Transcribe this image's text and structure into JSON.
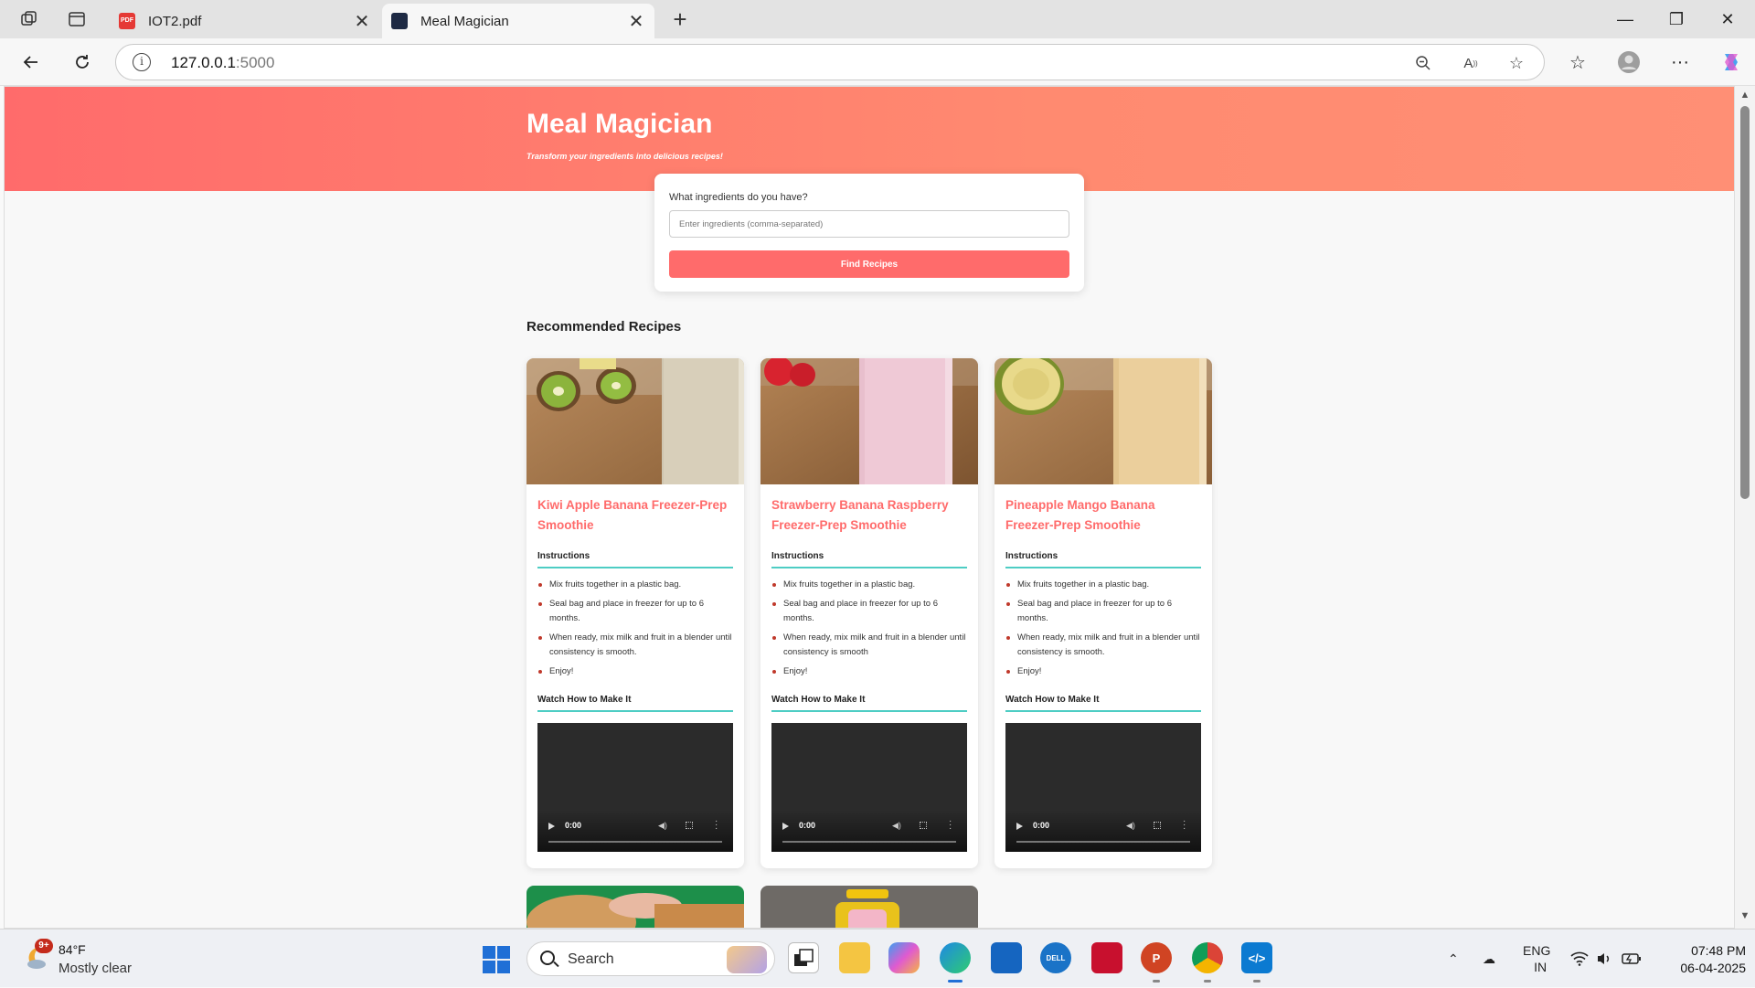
{
  "browser": {
    "tabs": [
      {
        "title": "IOT2.pdf",
        "active": false,
        "icon": "pdf-icon"
      },
      {
        "title": "Meal Magician",
        "active": true,
        "icon": "terminal-icon"
      }
    ],
    "url_host": "127.0.0.1",
    "url_port": ":5000"
  },
  "page": {
    "title": "Meal Magician",
    "tagline": "Transform your ingredients into delicious recipes!",
    "search": {
      "label": "What ingredients do you have?",
      "placeholder": "Enter ingredients (comma-separated)",
      "button": "Find Recipes"
    },
    "section_title": "Recommended Recipes",
    "instructions_heading": "Instructions",
    "video_heading": "Watch How to Make It",
    "video_time": "0:00",
    "recipes": [
      {
        "name": "Kiwi Apple Banana Freezer-Prep Smoothie",
        "steps": [
          "Mix fruits together in a plastic bag.",
          "Seal bag and place in freezer for up to 6 months.",
          "When ready, mix milk and fruit in a blender until consistency is smooth.",
          "Enjoy!"
        ]
      },
      {
        "name": "Strawberry Banana Raspberry Freezer-Prep Smoothie",
        "steps": [
          "Mix fruits together in a plastic bag.",
          "Seal bag and place in freezer for up to 6 months.",
          "When ready, mix milk and fruit in a blender until consistency is smooth",
          "Enjoy!"
        ]
      },
      {
        "name": "Pineapple Mango Banana Freezer-Prep Smoothie",
        "steps": [
          "Mix fruits together in a plastic bag.",
          "Seal bag and place in freezer for up to 6 months.",
          "When ready, mix milk and fruit in a blender until consistency is smooth.",
          "Enjoy!"
        ]
      }
    ]
  },
  "taskbar": {
    "weather_badge": "9+",
    "temperature": "84°F",
    "condition": "Mostly clear",
    "search_label": "Search",
    "lang_line1": "ENG",
    "lang_line2": "IN",
    "time": "07:48 PM",
    "date": "06-04-2025"
  },
  "colors": {
    "accent": "#ff6b6b",
    "divider": "#4ecdc4",
    "hero_end": "#ff8f75"
  }
}
